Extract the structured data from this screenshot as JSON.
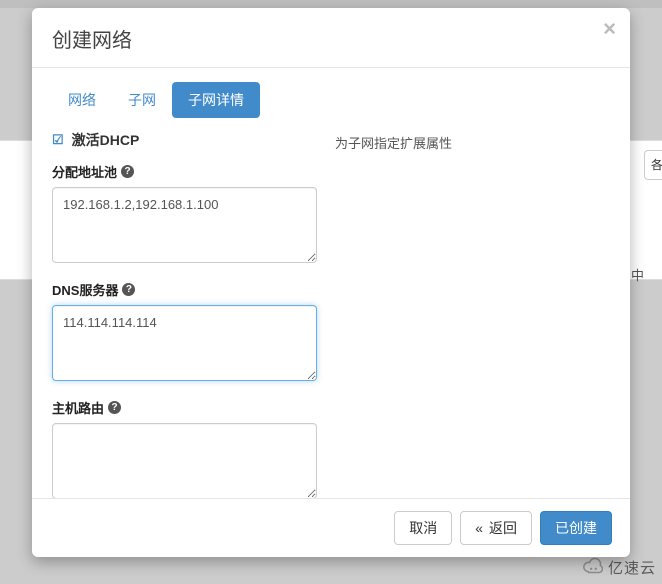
{
  "modal": {
    "title": "创建网络",
    "tabs": [
      {
        "label": "网络",
        "active": false
      },
      {
        "label": "子网",
        "active": false
      },
      {
        "label": "子网详情",
        "active": true
      }
    ],
    "dhcp": {
      "checked": true,
      "label": "激活DHCP"
    },
    "help_text": "为子网指定扩展属性",
    "fields": {
      "allocation_pools": {
        "label": "分配地址池",
        "value": "192.168.1.2,192.168.1.100"
      },
      "dns_nameservers": {
        "label": "DNS服务器",
        "value": "114.114.114.114"
      },
      "host_routes": {
        "label": "主机路由",
        "value": ""
      }
    },
    "buttons": {
      "cancel": "取消",
      "back_symbol": "«",
      "back_label": "返回",
      "submit": "已创建"
    }
  },
  "background": {
    "button_partial": "各",
    "page_text_partial": "中",
    "logo_text": "亿速云"
  }
}
